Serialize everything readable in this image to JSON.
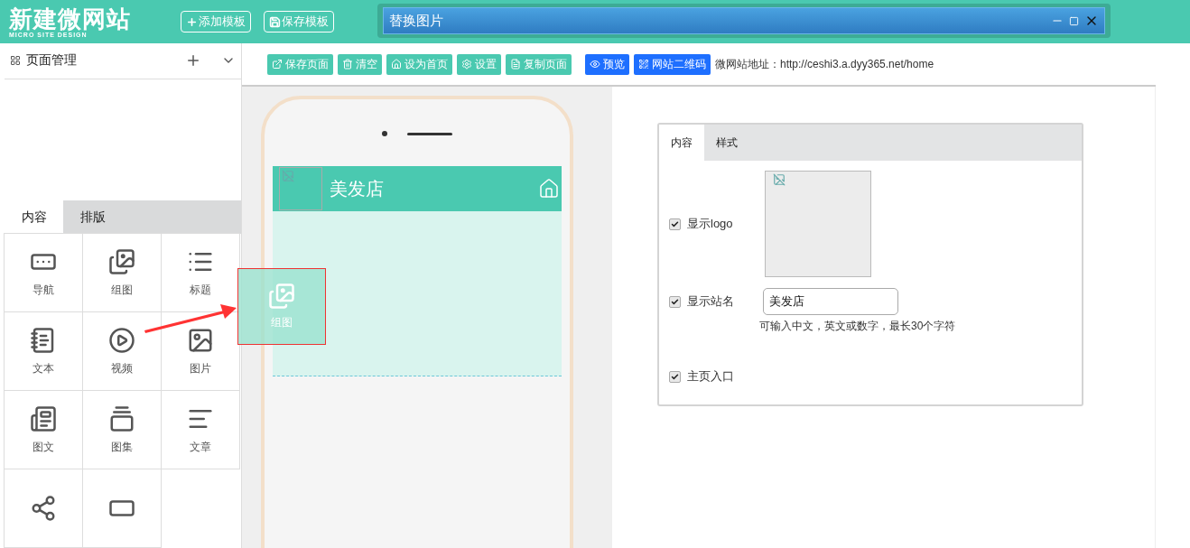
{
  "header": {
    "title": "新建微网站",
    "subtitle": "MICRO SITE DESIGN",
    "buttons": [
      {
        "kind": "add",
        "label": "添加模板"
      },
      {
        "kind": "save",
        "label": "保存模板"
      }
    ]
  },
  "dialog": {
    "title": "替换图片"
  },
  "sidebar": {
    "title": "页面管理",
    "tabs": [
      {
        "label": "内容",
        "selected": true
      },
      {
        "label": "排版",
        "selected": false
      }
    ],
    "widgets": [
      {
        "kind": "nav",
        "label": "导航"
      },
      {
        "kind": "gallery",
        "label": "组图"
      },
      {
        "kind": "title",
        "label": "标题"
      },
      {
        "kind": "text",
        "label": "文本"
      },
      {
        "kind": "video",
        "label": "视频"
      },
      {
        "kind": "image",
        "label": "图片"
      },
      {
        "kind": "image-text",
        "label": "图文"
      },
      {
        "kind": "album",
        "label": "图集"
      },
      {
        "kind": "article",
        "label": "文章"
      },
      {
        "kind": "share"
      },
      {
        "kind": "bar"
      }
    ]
  },
  "toolbar": {
    "buttons": [
      {
        "kind": "save-page",
        "label": "保存页面",
        "color": "#4ac9b0"
      },
      {
        "kind": "clear",
        "label": "清空",
        "color": "#4ac9b0"
      },
      {
        "kind": "home",
        "label": "设为首页",
        "color": "#4ac9b0"
      },
      {
        "kind": "settings",
        "label": "设置",
        "color": "#4ac9b0"
      },
      {
        "kind": "copy",
        "label": "复制页面",
        "color": "#4ac9b0"
      },
      {
        "kind": "preview",
        "label": "预览",
        "color": "#1e6fff"
      },
      {
        "kind": "qr",
        "label": "网站二维码",
        "color": "#1e6fff"
      }
    ],
    "site_address": "微网站地址：http://ceshi3.a.dyy365.net/home"
  },
  "phone": {
    "site_name": "美发店"
  },
  "drag_ghost": {
    "label": "组图"
  },
  "settings": {
    "tabs": [
      {
        "label": "内容",
        "selected": true
      },
      {
        "label": "样式",
        "selected": false
      }
    ],
    "rows": [
      {
        "kind": "logo",
        "label": "显示logo",
        "checked": true
      },
      {
        "kind": "text",
        "label": "显示站名",
        "checked": true,
        "value": "美发店",
        "hint": "可输入中文，英文或数字，最长30个字符"
      },
      {
        "kind": "plain",
        "label": "主页入口",
        "checked": true
      }
    ]
  }
}
